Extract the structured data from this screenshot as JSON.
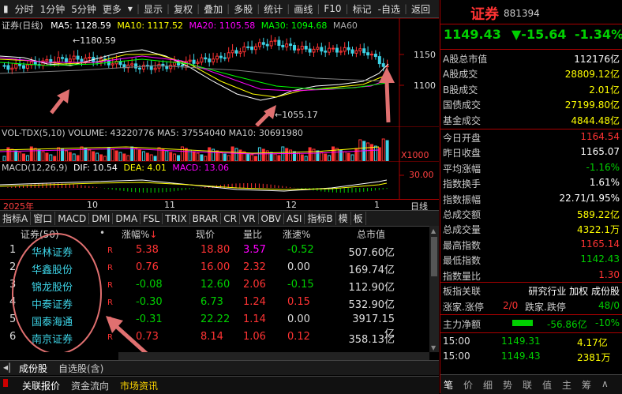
{
  "toolbar": {
    "items": [
      "分时",
      "1分钟",
      "5分钟",
      "更多",
      "显示",
      "复权",
      "叠加",
      "多股",
      "统计",
      "画线",
      "F10",
      "标记",
      "-自选",
      "返回"
    ]
  },
  "kline": {
    "title": "证券(日线)",
    "ma_labels": [
      "MA5: 1128.59",
      "MA10: 1117.52",
      "MA20: 1105.58",
      "MA30: 1094.68",
      "MA60"
    ],
    "ma_colors": [
      "#ffffff",
      "#ffff00",
      "#ff00ff",
      "#00ff00",
      "#808080"
    ],
    "high_label": "1180.59",
    "low_label": "1055.17",
    "price_axis": [
      "1150",
      "1100"
    ],
    "year_label": "2025年"
  },
  "volume": {
    "header": "VOL-TDX(5,10)  VOLUME: 43220776  MA5: 37554040  MA10: 30691980",
    "unit": "X1000"
  },
  "macd": {
    "header_name": "MACD(12,26,9)",
    "dif": "DIF: 10.54",
    "dea": "DEA: 4.01",
    "macd": "MACD: 13.06",
    "axis_value": "30.00"
  },
  "timeaxis": [
    "10",
    "11",
    "12",
    "1",
    "日线"
  ],
  "indicator_tabs": [
    "指标A",
    "窗口",
    "MACD",
    "DMI",
    "DMA",
    "FSL",
    "TRIX",
    "BRAR",
    "CR",
    "VR",
    "OBV",
    "ASI",
    "指标B",
    "模",
    "板"
  ],
  "table": {
    "headers": [
      "证券(50)",
      "•",
      "涨幅%",
      "现价",
      "量比",
      "涨速%",
      "总市值"
    ],
    "rows": [
      {
        "no": "1",
        "name": "华林证券",
        "flag": "R",
        "chg": "5.38",
        "price": "18.80",
        "vr": "3.57",
        "speed": "-0.52",
        "cap": "507.60亿"
      },
      {
        "no": "2",
        "name": "华鑫股份",
        "flag": "R",
        "chg": "0.76",
        "price": "16.00",
        "vr": "2.32",
        "speed": "0.00",
        "cap": "169.74亿"
      },
      {
        "no": "3",
        "name": "锦龙股份",
        "flag": "R",
        "chg": "-0.08",
        "price": "12.60",
        "vr": "2.06",
        "speed": "-0.15",
        "cap": "112.90亿"
      },
      {
        "no": "4",
        "name": "中泰证券",
        "flag": "R",
        "chg": "-0.30",
        "price": "6.73",
        "vr": "1.24",
        "speed": "0.15",
        "cap": "532.90亿"
      },
      {
        "no": "5",
        "name": "国泰海通",
        "flag": "R",
        "chg": "-0.31",
        "price": "22.22",
        "vr": "1.14",
        "speed": "0.00",
        "cap": "3917.15亿"
      },
      {
        "no": "6",
        "name": "南京证券",
        "flag": "R",
        "chg": "0.73",
        "price": "8.14",
        "vr": "1.06",
        "speed": "0.12",
        "cap": "358.13亿"
      }
    ]
  },
  "bottom_tabs": [
    "成份股",
    "自选股(含)"
  ],
  "status_tabs": [
    "关联报价",
    "资金流向",
    "市场资讯"
  ],
  "right": {
    "name": "证券",
    "code": "881394",
    "price": "1149.43",
    "change": "▼-15.64",
    "pct": "-1.34%",
    "rows1": [
      {
        "label": "A股总市值",
        "value": "112176亿",
        "cls": "white"
      },
      {
        "label": "A股成交",
        "value": "28809.12亿",
        "cls": "yellow"
      },
      {
        "label": "B股成交",
        "value": "2.01亿",
        "cls": "yellow"
      },
      {
        "label": "国债成交",
        "value": "27199.80亿",
        "cls": "yellow"
      },
      {
        "label": "基金成交",
        "value": "4844.48亿",
        "cls": "yellow"
      }
    ],
    "rows2": [
      {
        "label": "今日开盘",
        "value": "1164.54",
        "cls": "red"
      },
      {
        "label": "昨日收盘",
        "value": "1165.07",
        "cls": "white"
      },
      {
        "label": "平均涨幅",
        "value": "-1.16%",
        "cls": "green"
      },
      {
        "label": "指数换手",
        "value": "1.61%",
        "cls": "white"
      },
      {
        "label": "指数振幅",
        "value": "22.71/1.95%",
        "cls": "white"
      },
      {
        "label": "总成交额",
        "value": "589.22亿",
        "cls": "yellow"
      },
      {
        "label": "总成交量",
        "value": "4322.1万",
        "cls": "yellow"
      },
      {
        "label": "最高指数",
        "value": "1165.14",
        "cls": "red"
      },
      {
        "label": "最低指数",
        "value": "1142.43",
        "cls": "green"
      },
      {
        "label": "指数量比",
        "value": "1.30",
        "cls": "red"
      }
    ],
    "board": {
      "label": "板指关联",
      "links": "研究行业 加权 成份股"
    },
    "updown": {
      "up_label": "涨家.涨停",
      "up_val": "2/0",
      "down_label": "跌家.跌停",
      "down_val": "48/0"
    },
    "netflow": {
      "label": "主力净额",
      "value": "-56.86亿",
      "pct": "-10%"
    },
    "ticks": [
      {
        "time": "15:00",
        "price": "1149.31",
        "vol": "4.17亿"
      },
      {
        "time": "15:00",
        "price": "1149.43",
        "vol": "2381万"
      }
    ],
    "bottom_tabs": [
      "笔",
      "价",
      "细",
      "势",
      "联",
      "值",
      "主",
      "筹",
      "∧"
    ]
  }
}
